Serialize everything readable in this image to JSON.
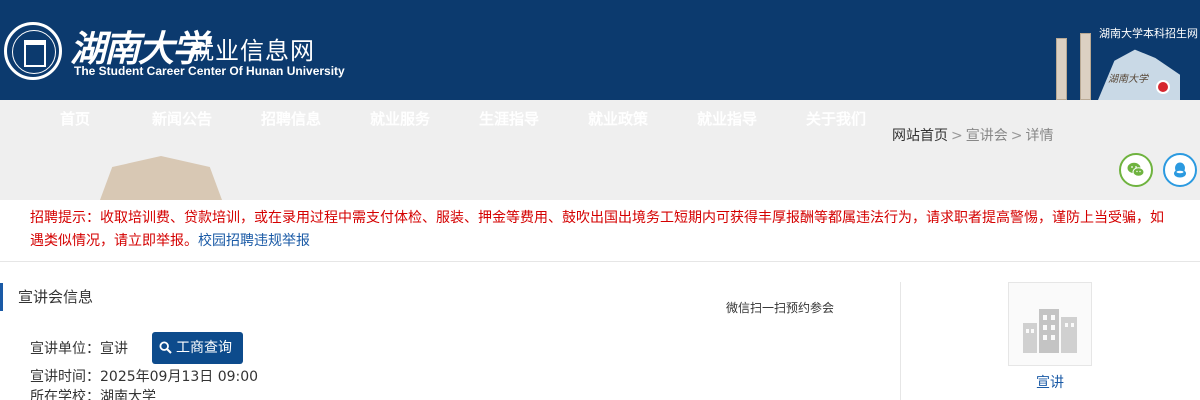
{
  "header": {
    "logo_script": "湖南大学",
    "site_title": "就业信息网",
    "site_subtitle": "The Student Career Center Of Hunan University",
    "top_link": "湖南大学本科招生网",
    "illustration_text": "湖南大学"
  },
  "nav": {
    "items": [
      "首页",
      "新闻公告",
      "招聘信息",
      "就业服务",
      "生涯指导",
      "就业政策",
      "就业指导",
      "关于我们"
    ]
  },
  "breadcrumb": {
    "home": "网站首页",
    "sep": ">",
    "level1": "宣讲会",
    "level2": "详情"
  },
  "notice": {
    "text": "招聘提示：收取培训费、贷款培训，或在录用过程中需支付体检、服装、押金等费用、鼓吹出国出境务工短期内可获得丰厚报酬等都属违法行为，请求职者提高警惕，谨防上当受骗，如遇类似情况，请立即举报。",
    "report_link": "校园招聘违规举报"
  },
  "main": {
    "section_title": "宣讲会信息",
    "scan_text": "微信扫一扫预约参会",
    "company_label": "宣讲单位：",
    "company_value": "宣讲",
    "business_button": "工商查询",
    "time_label": "宣讲时间：",
    "time_value": "2025年09月13日 09:00",
    "school_label": "所在学校：",
    "school_value": "湖南大学"
  },
  "sidebar": {
    "company_name": "宣讲"
  },
  "colors": {
    "header_bg": "#0c3a6e",
    "nav_bg": "#efefef",
    "notice_red": "#d40000",
    "link_blue": "#1a5aa6",
    "button_bg": "#0d4b8c",
    "wechat_green": "#6fb33f",
    "qq_blue": "#2b9ae0"
  },
  "icons": [
    "university-seal-icon",
    "wechat-icon",
    "qq-icon",
    "search-icon",
    "building-placeholder-icon"
  ]
}
